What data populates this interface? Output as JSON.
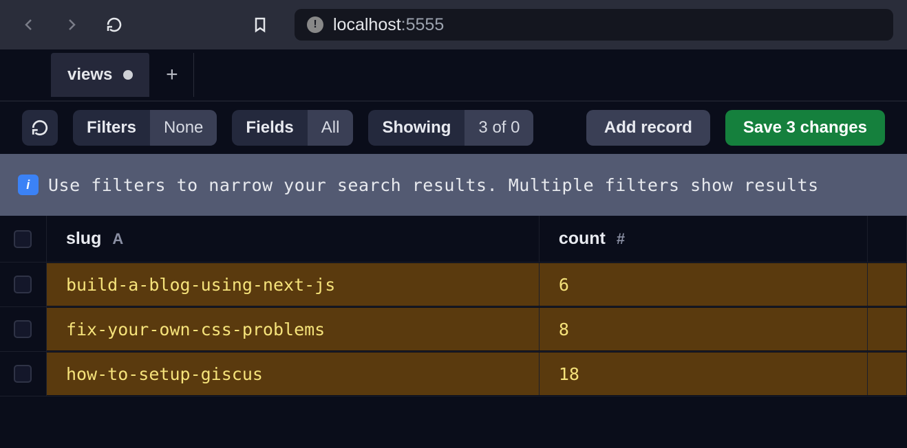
{
  "url": {
    "host": "localhost",
    "port": ":5555"
  },
  "tab": {
    "label": "views"
  },
  "toolbar": {
    "filters_label": "Filters",
    "filters_value": "None",
    "fields_label": "Fields",
    "fields_value": "All",
    "showing_label": "Showing",
    "showing_value": "3 of 0",
    "add_record": "Add record",
    "save_changes": "Save 3 changes"
  },
  "info_banner": "Use filters to narrow your search results. Multiple filters show results",
  "columns": {
    "slug": {
      "label": "slug",
      "type": "A"
    },
    "count": {
      "label": "count",
      "type": "#"
    }
  },
  "rows": [
    {
      "slug": "build-a-blog-using-next-js",
      "count": "6"
    },
    {
      "slug": "fix-your-own-css-problems",
      "count": "8"
    },
    {
      "slug": "how-to-setup-giscus",
      "count": "18"
    }
  ]
}
